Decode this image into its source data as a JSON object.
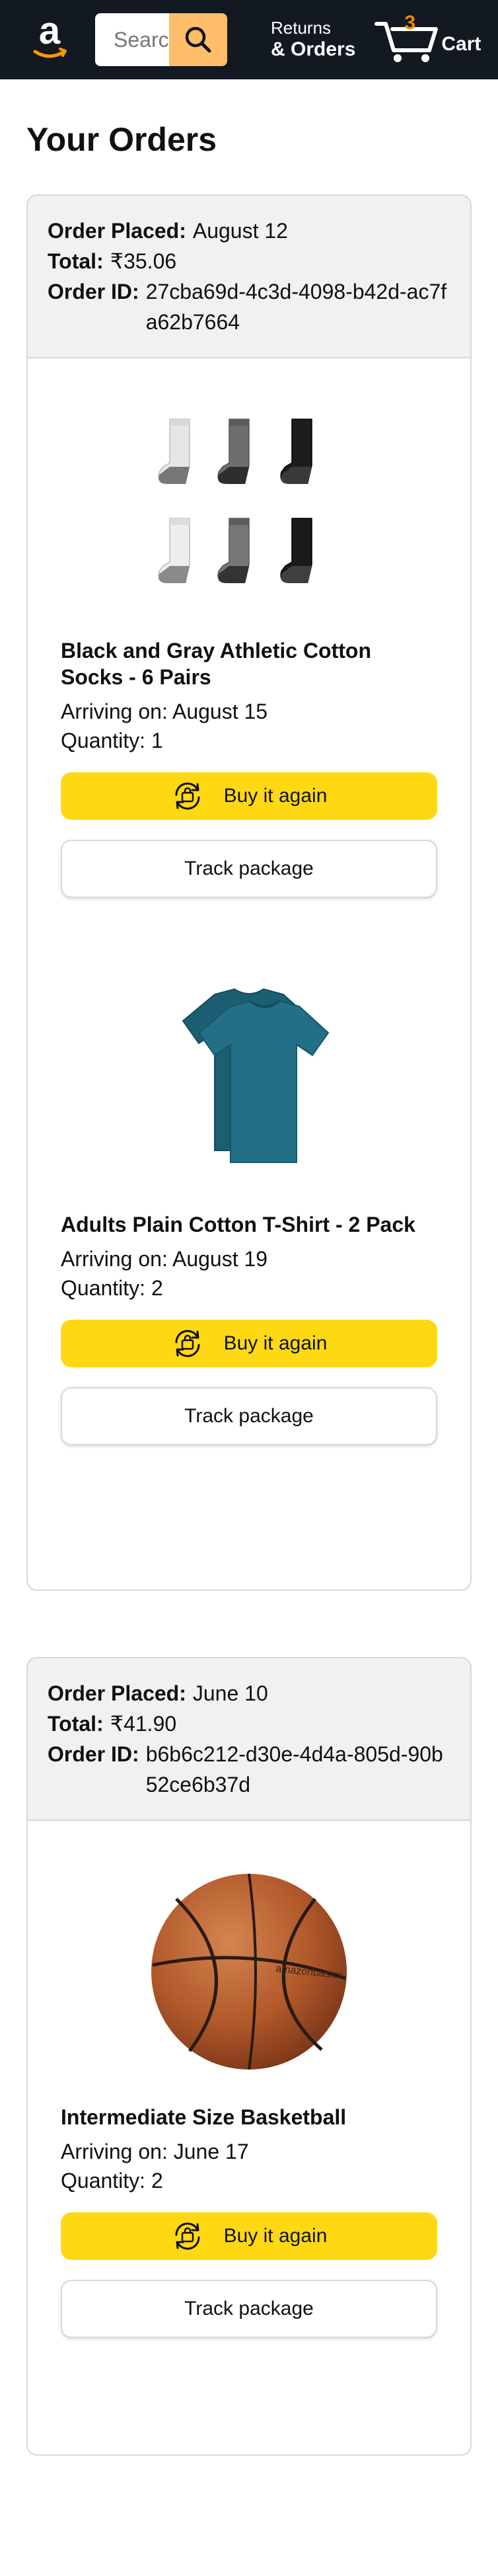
{
  "header": {
    "search_placeholder": "Search",
    "returns_line1": "Returns",
    "returns_line2": "& Orders",
    "cart_count": "3",
    "cart_label": "Cart",
    "accent_color": "#febd69",
    "bg_color": "#131921"
  },
  "page": {
    "title": "Your Orders"
  },
  "labels": {
    "order_placed": "Order Placed:",
    "total": "Total:",
    "order_id": "Order ID:",
    "arriving": "Arriving on:",
    "quantity": "Quantity:",
    "buy_again": "Buy it again",
    "track": "Track package"
  },
  "orders": [
    {
      "placed": "August 12",
      "total": "₹35.06",
      "order_id": "27cba69d-4c3d-4098-b42d-ac7fa62b7664",
      "items": [
        {
          "title": "Black and Gray Athletic Cotton Socks - 6 Pairs",
          "arriving": "August 15",
          "quantity": "1",
          "image_icon": "socks-image"
        },
        {
          "title": "Adults Plain Cotton T-Shirt - 2 Pack",
          "arriving": "August 19",
          "quantity": "2",
          "image_icon": "tshirt-image"
        }
      ]
    },
    {
      "placed": "June 10",
      "total": "₹41.90",
      "order_id": "b6b6c212-d30e-4d4a-805d-90b52ce6b37d",
      "items": [
        {
          "title": "Intermediate Size Basketball",
          "arriving": "June 17",
          "quantity": "2",
          "image_icon": "basketball-image"
        }
      ]
    }
  ]
}
